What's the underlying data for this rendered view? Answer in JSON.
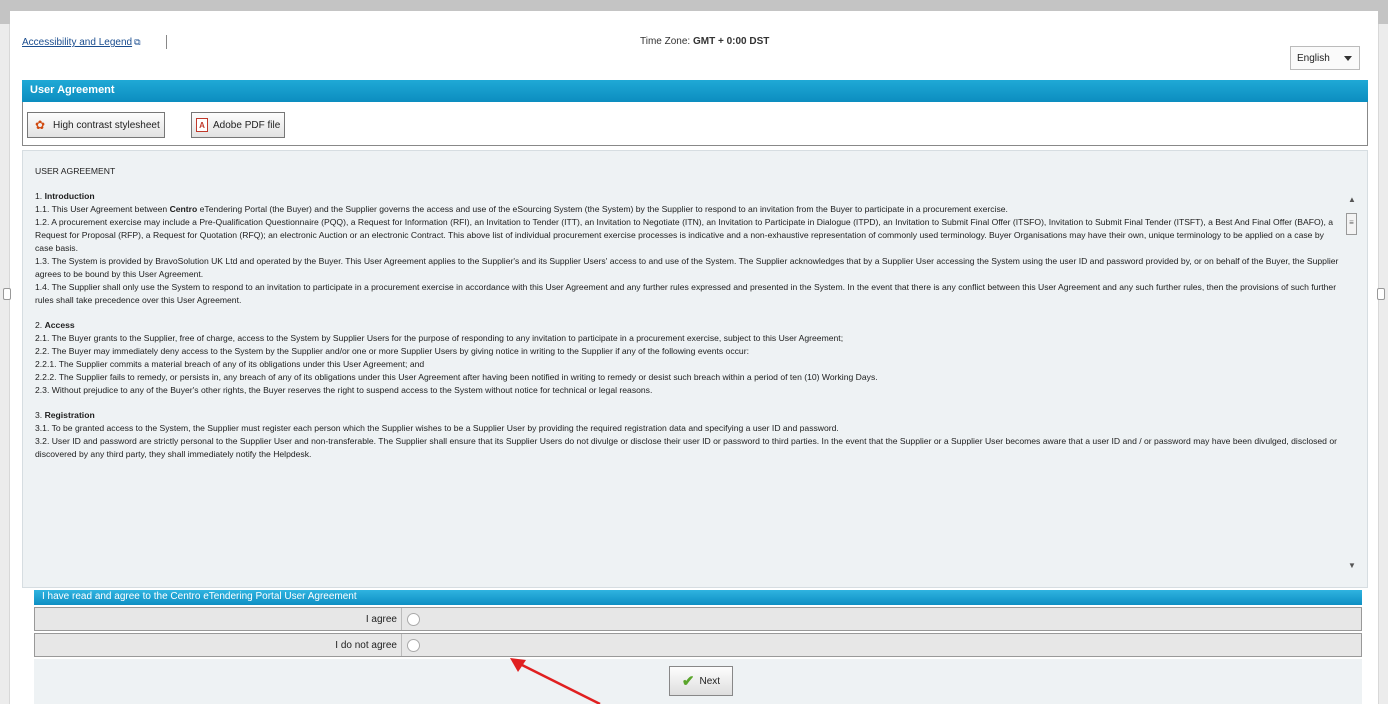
{
  "header": {
    "accessibility_link": "Accessibility and Legend",
    "timezone_label": "Time Zone:",
    "timezone_value": "GMT + 0:00 DST",
    "language": "English"
  },
  "panel": {
    "title": "User Agreement",
    "buttons": {
      "high_contrast": "High contrast stylesheet",
      "pdf": "Adobe PDF file"
    }
  },
  "agreement": {
    "heading": "USER AGREEMENT",
    "sections": [
      {
        "number": "1.",
        "title": "Introduction",
        "paragraphs": [
          {
            "pre": "1.1. This User Agreement between ",
            "bold": "Centro",
            "post": " eTendering Portal (the Buyer) and the Supplier governs the access and use of the eSourcing System (the System) by the Supplier to respond to an invitation from the Buyer to participate in a procurement exercise."
          },
          {
            "pre": "1.2. A procurement exercise may include a Pre-Qualification Questionnaire (PQQ), a Request for Information (RFI), an Invitation to Tender (ITT), an Invitation to Negotiate (ITN), an Invitation to Participate in Dialogue (ITPD), an Invitation to Submit Final Offer (ITSFO), Invitation to Submit Final Tender (ITSFT), a Best And Final Offer (BAFO), a Request for Proposal (RFP), a Request for Quotation (RFQ); an electronic Auction or an electronic Contract. This above list of individual procurement exercise processes is indicative and a non-exhaustive representation of commonly used terminology. Buyer Organisations may have their own, unique terminology to be applied on a case by case basis.",
            "bold": "",
            "post": ""
          },
          {
            "pre": "1.3. The System is provided by BravoSolution UK Ltd and operated by the Buyer. This User Agreement applies to the Supplier's and its Supplier Users' access to and use of the System. The Supplier acknowledges that by a Supplier User accessing the System using the user ID and password provided by, or on behalf of the Buyer, the Supplier agrees to be bound by this User Agreement.",
            "bold": "",
            "post": ""
          },
          {
            "pre": "1.4. The Supplier shall only use the System to respond to an invitation to participate in a procurement exercise in accordance with this User Agreement and any further rules expressed and presented in the System. In the event that there is any conflict between this User Agreement and any such further rules, then the provisions of such further rules shall take precedence over this User Agreement.",
            "bold": "",
            "post": ""
          }
        ]
      },
      {
        "number": "2.",
        "title": "Access",
        "paragraphs": [
          {
            "pre": "2.1. The Buyer grants to the Supplier, free of charge, access to the System by Supplier Users for the purpose of responding to any invitation to participate in a procurement exercise, subject to this User Agreement;",
            "bold": "",
            "post": ""
          },
          {
            "pre": "2.2. The Buyer may immediately deny access to the System by the Supplier and/or one or more Supplier Users by giving notice in writing to the Supplier if any of the following events occur:",
            "bold": "",
            "post": ""
          },
          {
            "pre": "2.2.1. The Supplier commits a material breach of any of its obligations under this User Agreement; and",
            "bold": "",
            "post": ""
          },
          {
            "pre": "2.2.2. The Supplier fails to remedy, or persists in, any breach of any of its obligations under this User Agreement after having been notified in writing to remedy or desist such breach within a period of ten (10) Working Days.",
            "bold": "",
            "post": ""
          },
          {
            "pre": "2.3. Without prejudice to any of the Buyer's other rights, the Buyer reserves the right to suspend access to the System without notice for technical or legal reasons.",
            "bold": "",
            "post": ""
          }
        ]
      },
      {
        "number": "3.",
        "title": "Registration",
        "paragraphs": [
          {
            "pre": "3.1. To be granted access to the System, the Supplier must register each person which the Supplier wishes to be a Supplier User by providing the required registration data and specifying a user ID and password.",
            "bold": "",
            "post": ""
          },
          {
            "pre": "3.2. User ID and password are strictly personal to the Supplier User and non-transferable. The Supplier shall ensure that its Supplier Users do not divulge or disclose their user ID or password to third parties. In the event that the Supplier or a Supplier User becomes aware that a user ID and / or password may have been divulged, disclosed or discovered by any third party, they shall immediately notify the Helpdesk.",
            "bold": "",
            "post": ""
          }
        ]
      }
    ]
  },
  "acceptance": {
    "header": "I have read and agree to the Centro eTendering Portal User Agreement",
    "agree_label": "I agree",
    "disagree_label": "I do not agree",
    "next_label": "Next"
  }
}
